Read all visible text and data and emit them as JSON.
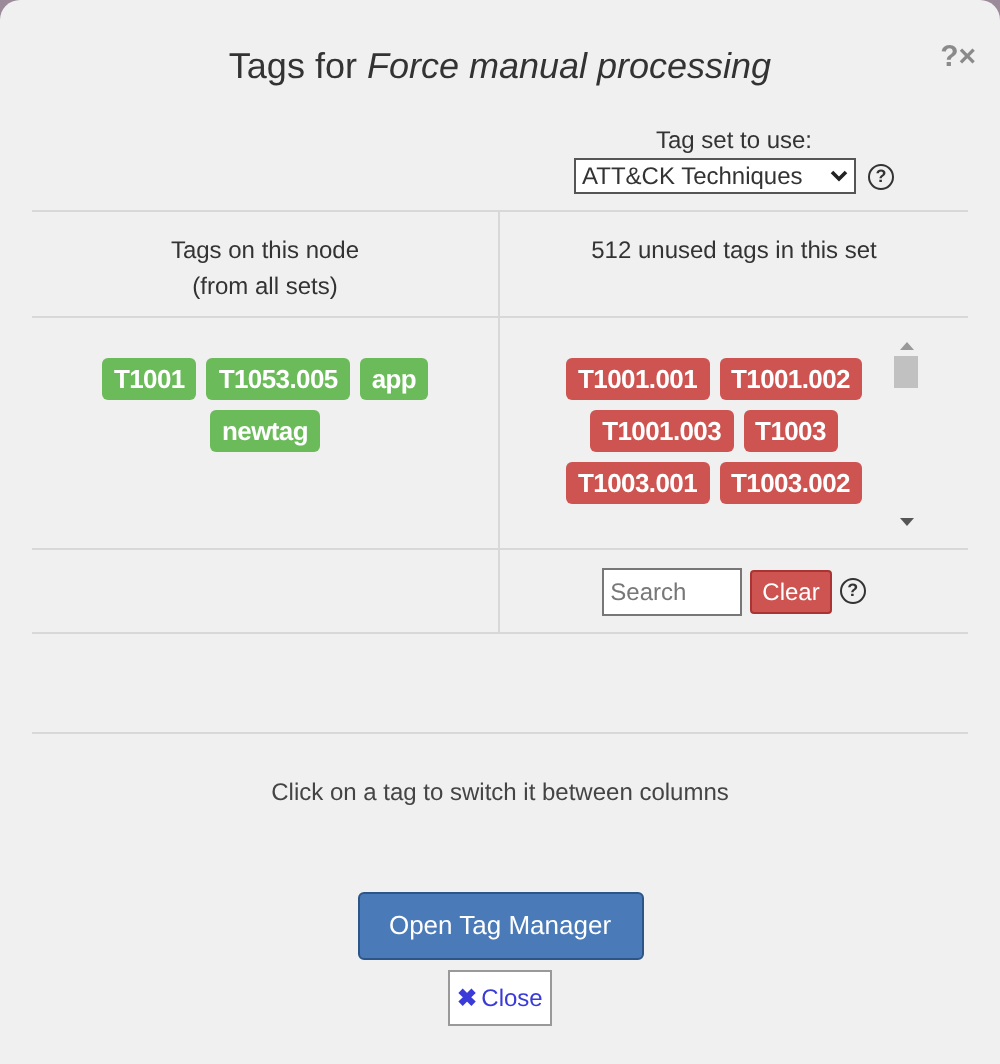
{
  "title": "Tags for *Force manual processing*",
  "help_glyph": "?",
  "close_glyph": "×",
  "tag_set": {
    "label": "Tag set to use:",
    "value": "ATT&CK Techniques",
    "help": "?"
  },
  "columns": [
    {
      "heading": "Tags on this node",
      "subheading": "(from all sets)"
    },
    {
      "heading": "512 unused tags in this set"
    }
  ],
  "node_tags": [
    {
      "label": "T1001",
      "color": "#6cbb5a"
    },
    {
      "label": "T1053.005",
      "color": "#6cbb5a"
    },
    {
      "label": "app",
      "color": "#6cbb5a"
    },
    {
      "label": "newtag",
      "color": "#6cbb5a"
    }
  ],
  "unused_tags": [
    {
      "label": "T1001.001",
      "color": "#cd5450"
    },
    {
      "label": "T1001.002",
      "color": "#cd5450"
    },
    {
      "label": "T1001.003",
      "color": "#cd5450"
    },
    {
      "label": "T1003",
      "color": "#cd5450"
    },
    {
      "label": "T1003.001",
      "color": "#cd5450"
    },
    {
      "label": "T1003.002",
      "color": "#cd5450"
    }
  ],
  "search": {
    "placeholder": "Search",
    "clear": "Clear",
    "help": "?"
  },
  "hint": "Click on a tag to switch it between columns",
  "buttons": {
    "manager": "Open Tag Manager",
    "close_icon": "✖",
    "close": "Close"
  }
}
